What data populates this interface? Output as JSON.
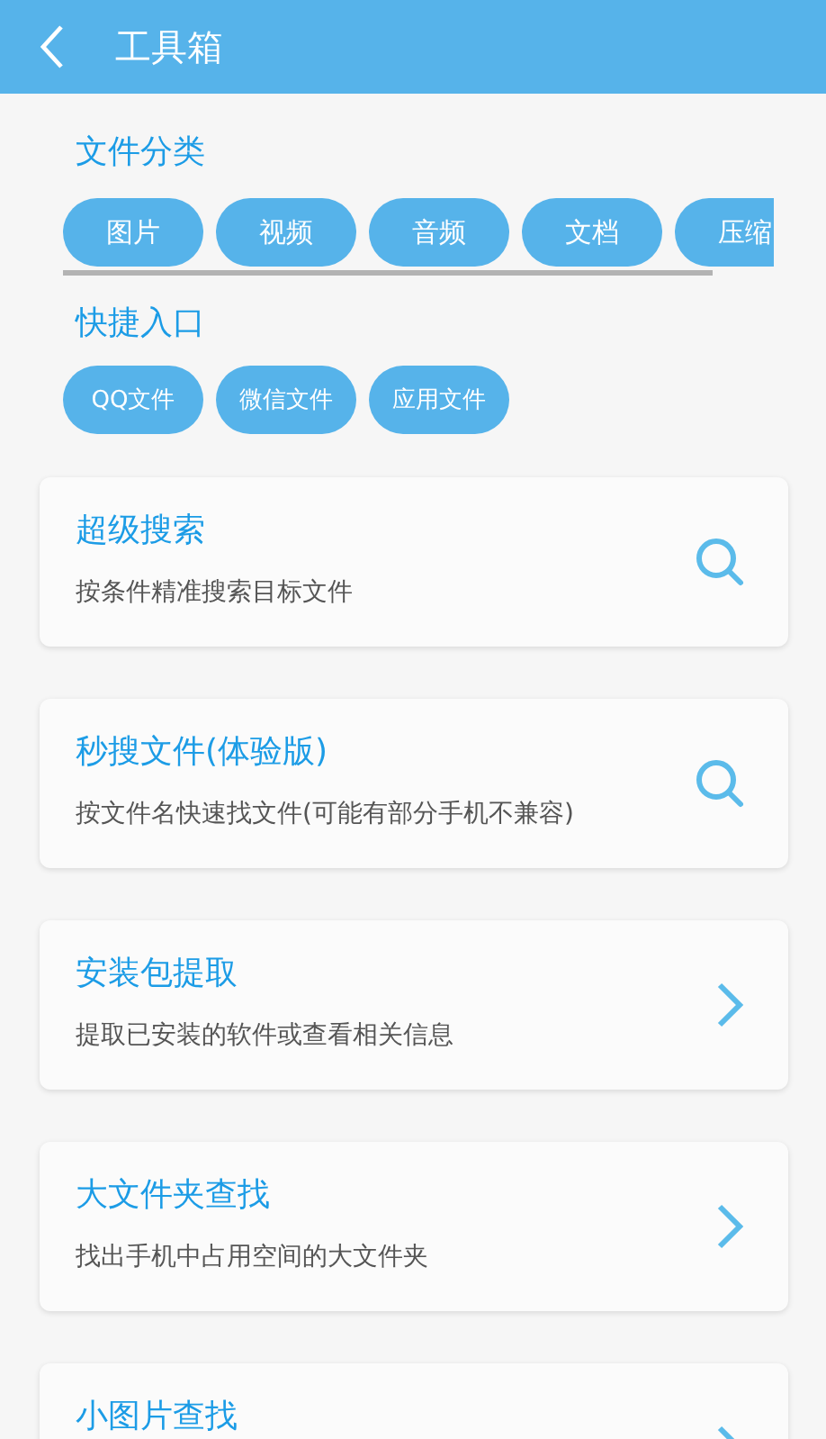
{
  "header": {
    "title": "工具箱"
  },
  "categories": {
    "title": "文件分类",
    "chips": [
      "图片",
      "视频",
      "音频",
      "文档",
      "压缩"
    ]
  },
  "shortcuts": {
    "title": "快捷入口",
    "chips": [
      "QQ文件",
      "微信文件",
      "应用文件"
    ]
  },
  "tools": [
    {
      "title": "超级搜索",
      "description": "按条件精准搜索目标文件",
      "kind": "search"
    },
    {
      "title": "秒搜文件(体验版)",
      "description": "按文件名快速找文件(可能有部分手机不兼容)",
      "kind": "search"
    },
    {
      "title": "安装包提取",
      "description": "提取已安装的软件或查看相关信息",
      "kind": "arrow"
    },
    {
      "title": "大文件夹查找",
      "description": "找出手机中占用空间的大文件夹",
      "kind": "arrow"
    },
    {
      "title": "小图片查找",
      "kind": "arrow"
    }
  ]
}
